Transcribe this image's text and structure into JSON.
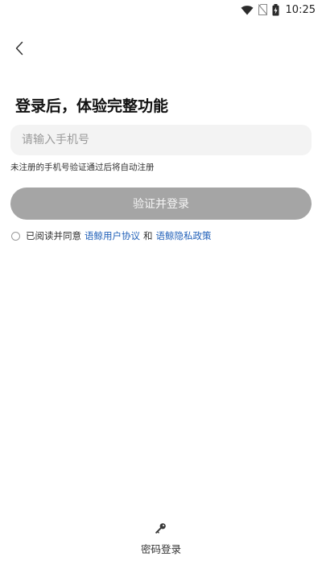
{
  "status_bar": {
    "time": "10:25",
    "icons": [
      "wifi-icon",
      "no-sim-icon",
      "battery-charging-icon"
    ]
  },
  "header": {
    "back_icon": "chevron-left-icon"
  },
  "main": {
    "title": "登录后，体验完整功能",
    "phone_placeholder": "请输入手机号",
    "phone_value": "",
    "hint": "未注册的手机号验证通过后将自动注册",
    "login_button_label": "验证并登录"
  },
  "agreement": {
    "prefix": "已阅读并同意",
    "user_agreement": "语鲸用户协议",
    "conjunction": "和",
    "privacy_policy": "语鲸隐私政策"
  },
  "footer": {
    "password_login_label": "密码登录",
    "icon": "key-icon"
  },
  "colors": {
    "link": "#1f5fb8",
    "button_disabled": "#a5a5a5",
    "input_bg": "#f3f3f3"
  }
}
